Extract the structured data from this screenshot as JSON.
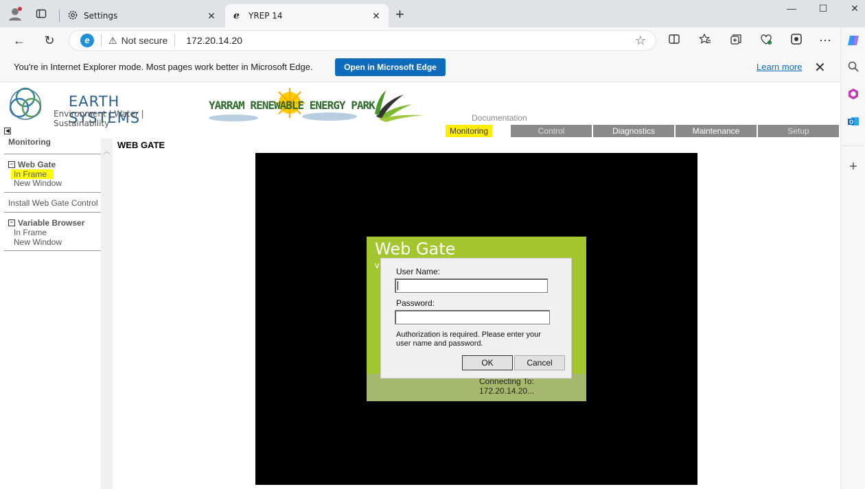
{
  "browser": {
    "tabs": [
      {
        "label": "Settings",
        "icon": "gear-icon"
      },
      {
        "label": "YREP 14",
        "icon": "ie-icon"
      }
    ],
    "address": {
      "security_label": "Not secure",
      "url": "172.20.14.20"
    },
    "ie_banner": {
      "message": "You're in Internet Explorer mode. Most pages work better in Microsoft Edge.",
      "open_button": "Open in Microsoft Edge",
      "learn_more": "Learn more"
    }
  },
  "page": {
    "logo": {
      "title": "EARTH SYSTEMS",
      "subtitle": "Environment | Water | Sustainability"
    },
    "banner": {
      "text": "YARRAM RENEWABLE ENERGY PARK"
    },
    "nav": {
      "documentation": "Documentation",
      "tabs": [
        "Monitoring",
        "Control",
        "Diagnostics",
        "Maintenance",
        "Setup"
      ]
    },
    "sidebar": {
      "title": "Monitoring",
      "sections": [
        {
          "label": "Web Gate",
          "items": [
            "In Frame",
            "New Window"
          ]
        },
        {
          "label": "Install Web Gate Control"
        },
        {
          "label": "Variable Browser",
          "items": [
            "In Frame",
            "New Window"
          ]
        }
      ]
    },
    "main": {
      "heading": "WEB GATE",
      "webgate_title": "Web Gate",
      "webgate_version_prefix": "v",
      "connecting": "Connecting To: 172.20.14.20..."
    },
    "dialog": {
      "username_label": "User Name:",
      "username_value": "",
      "password_label": "Password:",
      "password_value": "",
      "note": "Authorization is required.  Please enter your user name and password.",
      "ok": "OK",
      "cancel": "Cancel"
    }
  },
  "colors": {
    "highlight": "#ffee00",
    "webgate_green": "#a3c62e",
    "edge_blue": "#0f6cbd"
  }
}
